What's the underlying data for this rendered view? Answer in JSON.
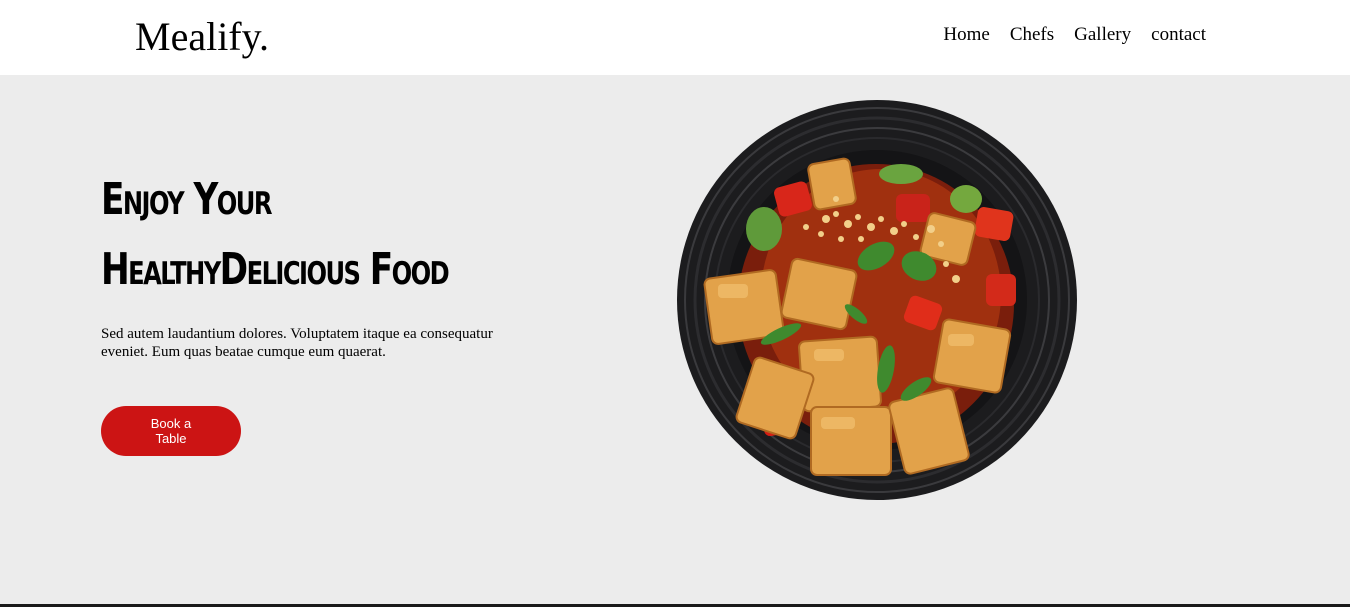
{
  "header": {
    "logo": "Mealify.",
    "nav": [
      {
        "label": "Home"
      },
      {
        "label": "Chefs"
      },
      {
        "label": "Gallery"
      },
      {
        "label": "contact"
      }
    ]
  },
  "hero": {
    "headline_line1": "Enjoy Your",
    "headline_line2": "HealthyDelicious Food",
    "description": "Sed autem laudantium dolores. Voluptatem itaque ea consequatur eveniet. Eum quas beatae cumque eum quaerat.",
    "button_label": "Book a Table",
    "image": "bowl-of-tofu-with-peppers-and-herbs"
  },
  "colors": {
    "header_bg": "#ffffff",
    "hero_bg": "#ececec",
    "accent": "#cc1414"
  }
}
